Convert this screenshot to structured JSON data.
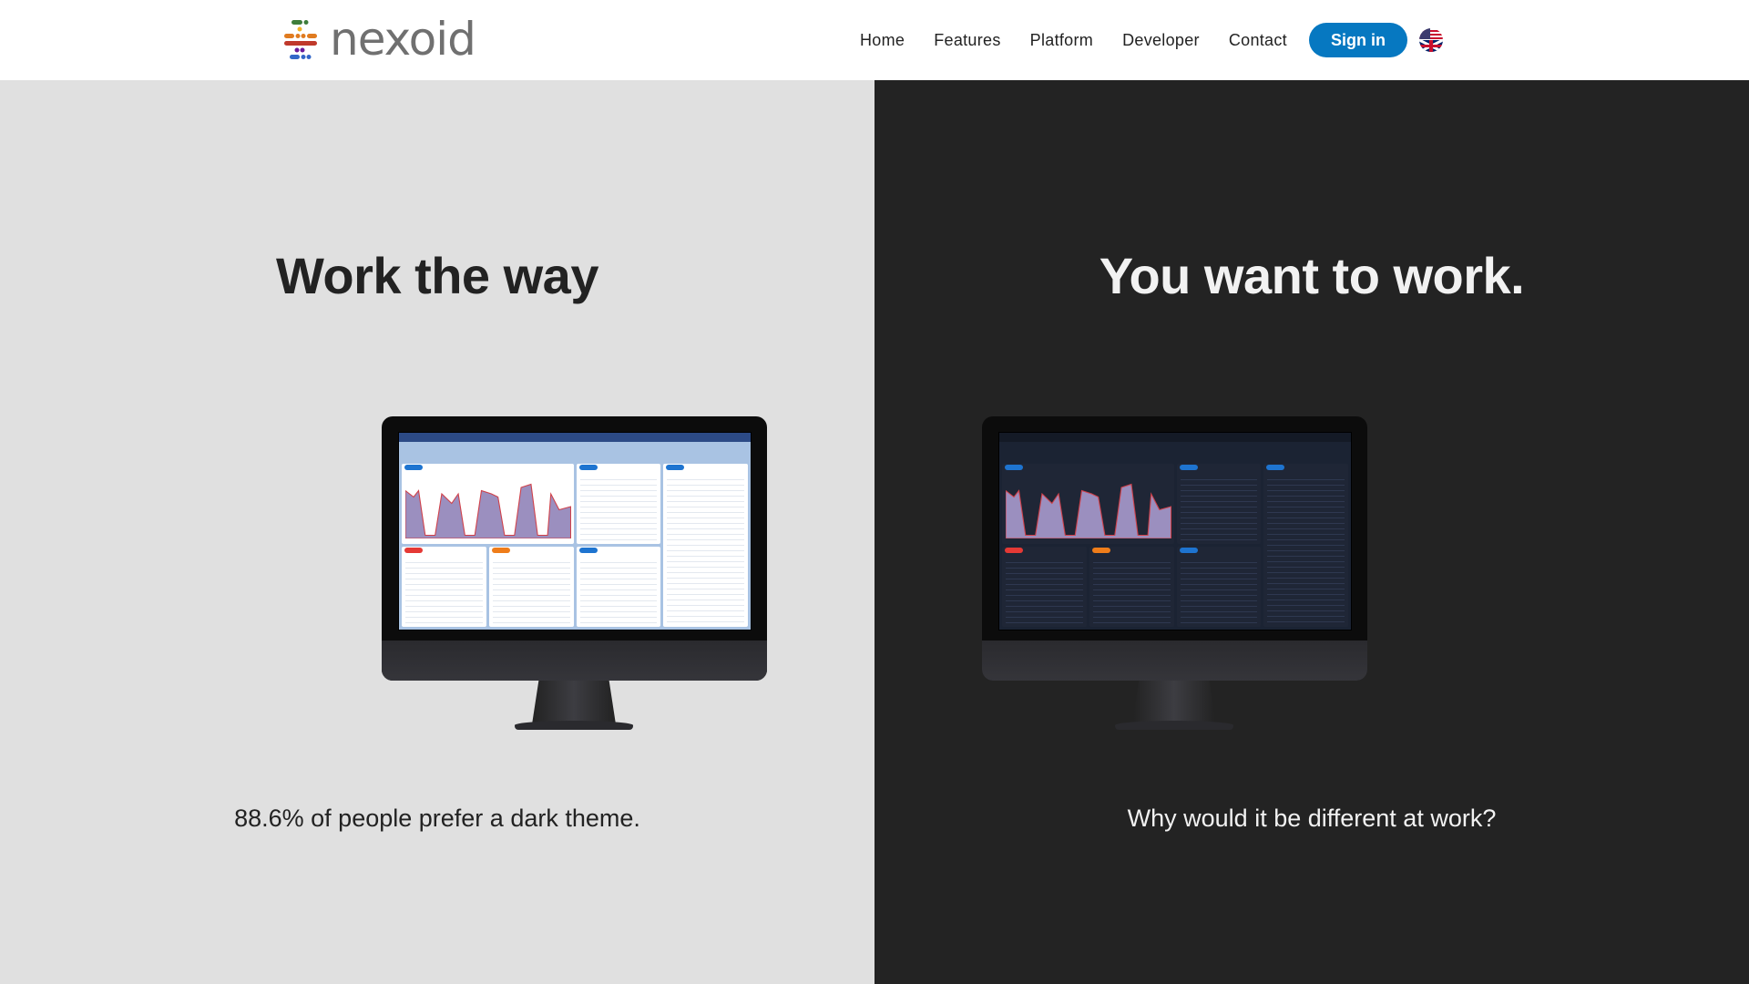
{
  "header": {
    "logo_text": "nexoid",
    "nav": [
      "Home",
      "Features",
      "Platform",
      "Developer",
      "Contact"
    ],
    "sign_in_label": "Sign in",
    "language_icon": "uk-flag-icon"
  },
  "hero": {
    "left": {
      "headline": "Work the way",
      "caption": "88.6% of people prefer a dark theme.",
      "theme": "light"
    },
    "right": {
      "headline": "You want to work.",
      "caption": "Why would it be different at work?",
      "theme": "dark"
    }
  },
  "colors": {
    "accent": "#0678c1",
    "light_bg": "#e0e0e0",
    "dark_bg": "#232323"
  }
}
